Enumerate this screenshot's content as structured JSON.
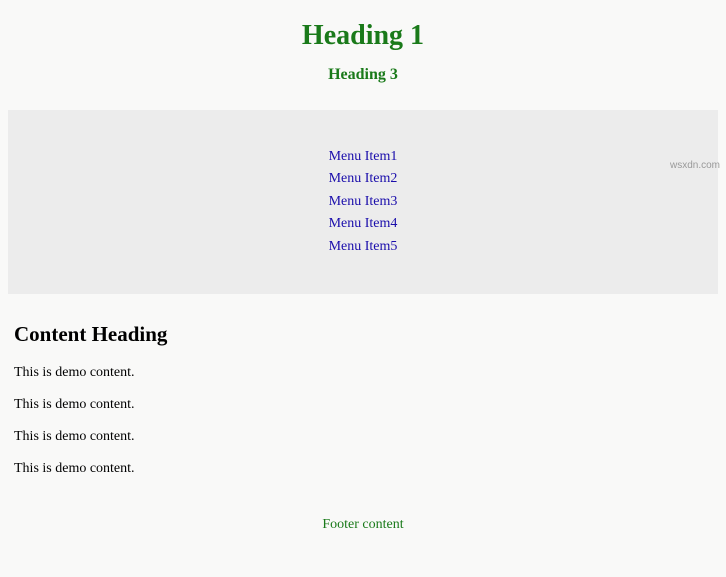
{
  "header": {
    "h1": "Heading 1",
    "h3": "Heading 3"
  },
  "menu": {
    "items": [
      "Menu Item1",
      "Menu Item2",
      "Menu Item3",
      "Menu Item4",
      "Menu Item5"
    ]
  },
  "content": {
    "heading": "Content Heading",
    "paragraphs": [
      "This is demo content.",
      "This is demo content.",
      "This is demo content.",
      "This is demo content."
    ]
  },
  "footer": {
    "text": "Footer content"
  },
  "watermark": "wsxdn.com"
}
